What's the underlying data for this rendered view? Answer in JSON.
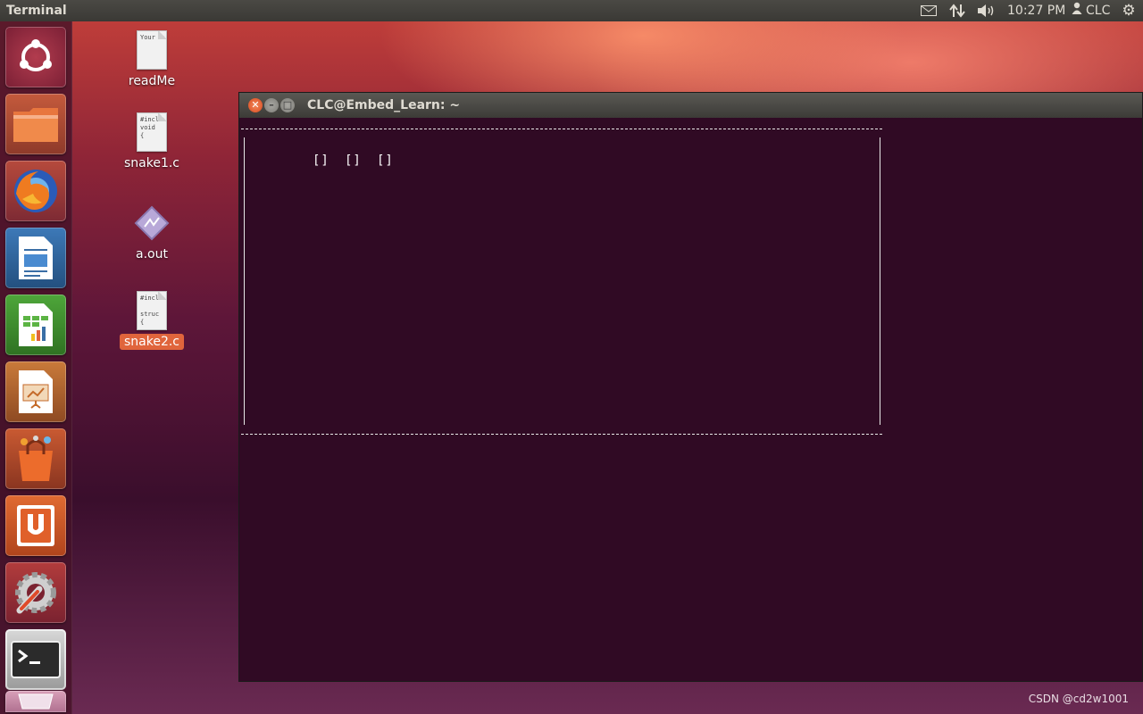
{
  "top_panel": {
    "app_title": "Terminal",
    "clock": "10:27 PM",
    "user": "CLC",
    "icons": [
      "mail-icon",
      "network-icon",
      "sound-icon",
      "user-icon",
      "gear-icon"
    ]
  },
  "launcher": {
    "items": [
      "dash-home",
      "files",
      "firefox",
      "libreoffice-writer",
      "libreoffice-calc",
      "libreoffice-impress",
      "software-center",
      "ubuntu-one",
      "system-settings",
      "terminal",
      "trash"
    ]
  },
  "desktop": {
    "icons": [
      {
        "label": "readMe",
        "preview": "Your"
      },
      {
        "label": "snake1.c",
        "preview": "#incl\nvoid\n{"
      },
      {
        "label": "a.out",
        "preview": ""
      },
      {
        "label": "snake2.c",
        "preview": "#incl\n\nstruc\n{",
        "selected": true
      }
    ]
  },
  "terminal": {
    "title": "CLC@Embed_Learn: ~",
    "snake_segments": [
      "[]",
      "[]",
      "[]"
    ]
  },
  "watermark": "CSDN @cd2w1001",
  "colors": {
    "terminal_bg": "#300a24",
    "panel_bg": "#3c3b37",
    "selection": "#e0653c"
  }
}
